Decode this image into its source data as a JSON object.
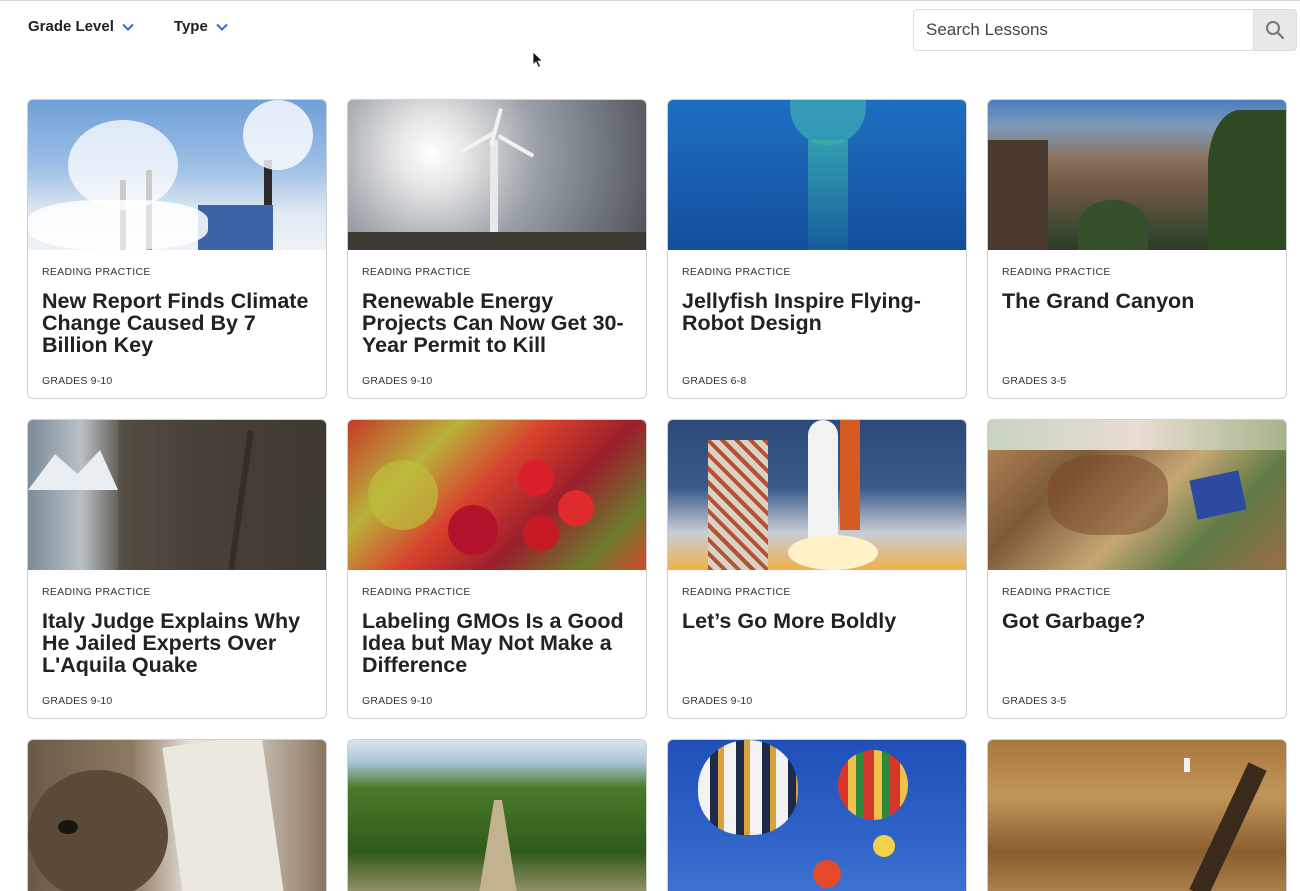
{
  "filters": {
    "grade_level": "Grade Level",
    "type": "Type"
  },
  "search": {
    "placeholder": "Search Lessons"
  },
  "accent_color": "#2a6fd6",
  "lessons": [
    {
      "label": "READING PRACTICE",
      "title": "New Report Finds Climate Change Caused By 7 Billion Key",
      "grades": "GRADES 9-10",
      "image": "smokestacks-photo"
    },
    {
      "label": "READING PRACTICE",
      "title": "Renewable Energy Projects Can Now Get 30-Year Permit to Kill",
      "grades": "GRADES 9-10",
      "image": "wind-turbine-photo"
    },
    {
      "label": "READING PRACTICE",
      "title": "Jellyfish Inspire Flying-Robot Design",
      "grades": "GRADES 6-8",
      "image": "jellyfish-photo"
    },
    {
      "label": "READING PRACTICE",
      "title": "The Grand Canyon",
      "grades": "GRADES 3-5",
      "image": "grand-canyon-photo"
    },
    {
      "label": "READING PRACTICE",
      "title": "Italy Judge Explains Why He Jailed Experts Over L'Aquila Quake",
      "grades": "GRADES 9-10",
      "image": "cracked-building-photo"
    },
    {
      "label": "READING PRACTICE",
      "title": "Labeling GMOs Is a Good Idea but May Not Make a Difference",
      "grades": "GRADES 9-10",
      "image": "produce-photo"
    },
    {
      "label": "READING PRACTICE",
      "title": "Let’s Go More Boldly",
      "grades": "GRADES 9-10",
      "image": "space-shuttle-photo"
    },
    {
      "label": "READING PRACTICE",
      "title": "Got Garbage?",
      "grades": "GRADES 3-5",
      "image": "garbage-pile-photo"
    },
    {
      "image": "monkey-book-photo"
    },
    {
      "image": "corn-field-photo"
    },
    {
      "image": "hot-air-balloons-photo"
    },
    {
      "image": "excavation-trench-photo"
    }
  ]
}
